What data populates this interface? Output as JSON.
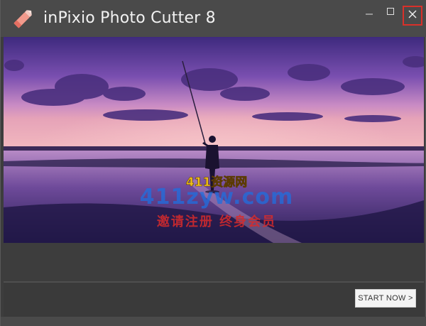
{
  "titlebar": {
    "title": "inPixio Photo Cutter 8",
    "logo_icon": "pencil-eraser-icon",
    "minimize_icon": "minimize-icon",
    "maximize_icon": "maximize-icon",
    "close_icon": "close-icon",
    "close_highlight_color": "#d9302a"
  },
  "hero": {
    "watermark_line1": "411资源网",
    "watermark_line2": "411zyw.com",
    "watermark_line3": "邀请注册 终身会员"
  },
  "footer": {
    "start_button_label": "START NOW >"
  },
  "colors": {
    "window_bg": "#3d3d3d",
    "titlebar_bg": "#4a4a4a",
    "button_bg": "#f4f4f4"
  }
}
